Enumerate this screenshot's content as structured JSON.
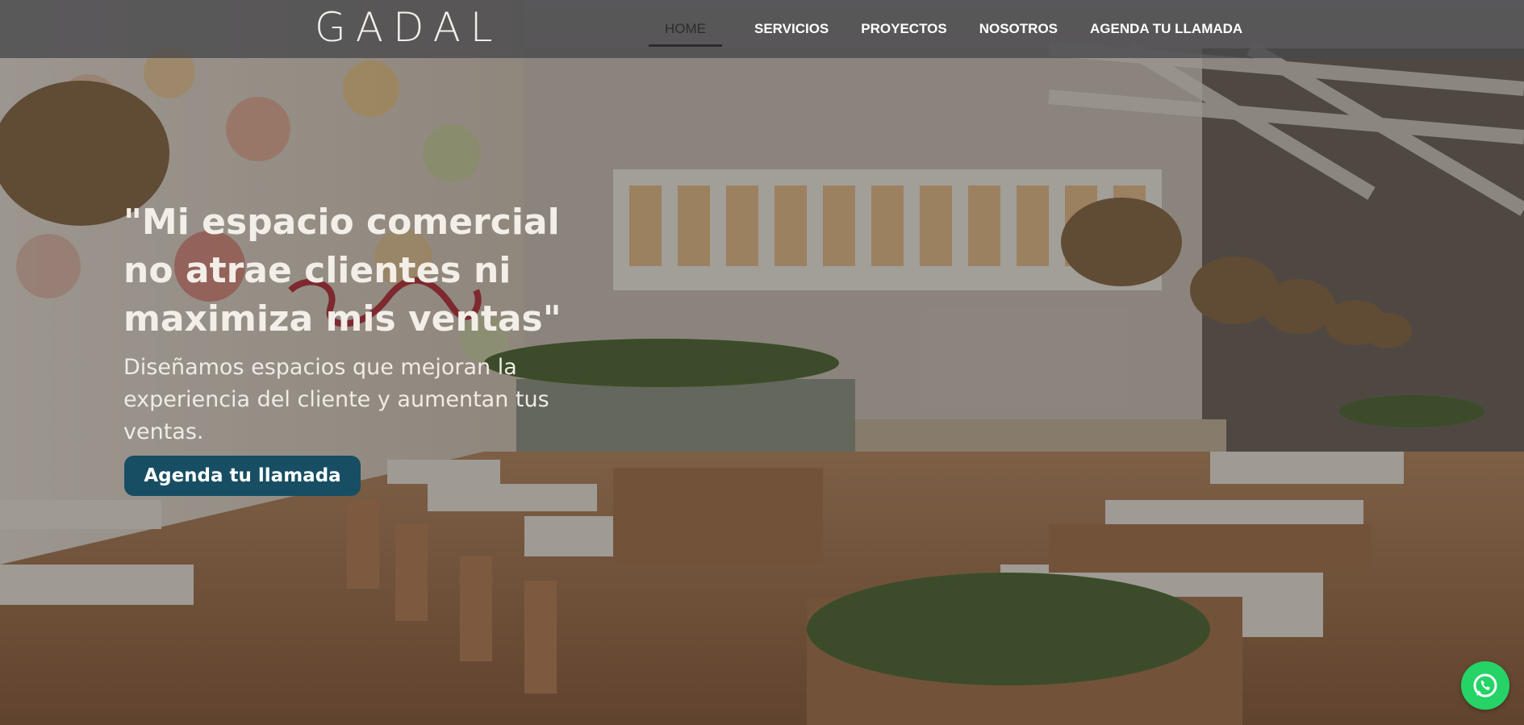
{
  "brand": {
    "logo_text": "GADAL"
  },
  "nav": {
    "items": [
      {
        "label": "HOME",
        "active": true
      },
      {
        "label": "SERVICIOS",
        "active": false
      },
      {
        "label": "PROYECTOS",
        "active": false
      },
      {
        "label": "NOSOTROS",
        "active": false
      },
      {
        "label": "AGENDA TU LLAMADA",
        "active": false
      }
    ]
  },
  "hero": {
    "headline": "\"Mi espacio comercial no atrae clientes ni maximiza mis ventas\"",
    "subtext": "Diseñamos espacios que mejoran la experiencia del cliente y aumentan tus ventas.",
    "cta_label": "Agenda tu llamada"
  },
  "floating": {
    "icon": "whatsapp-icon"
  },
  "colors": {
    "header_bg": "#48484c",
    "cta_bg": "#174e63",
    "whatsapp": "#25d366",
    "text_light": "#f3eee8"
  }
}
